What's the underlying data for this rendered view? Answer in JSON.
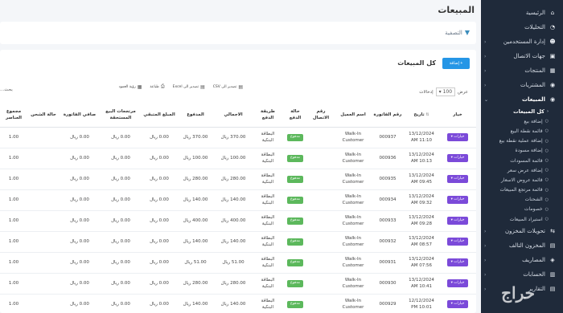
{
  "page": {
    "title": "المبيعات"
  },
  "filter": {
    "label": "التصفية"
  },
  "card": {
    "title": "كل المبيعات",
    "add_label": "+ إضافة"
  },
  "length": {
    "show_label": "عرض",
    "value": "100",
    "entries_label": "إدخالات"
  },
  "exports": [
    {
      "label": "تصدير الى CSV",
      "icon": "file-csv-icon",
      "glyph": "▤"
    },
    {
      "label": "تصدير الى Excel",
      "icon": "file-excel-icon",
      "glyph": "▤"
    },
    {
      "label": "طباعة",
      "icon": "print-icon",
      "glyph": "⎙"
    },
    {
      "label": "رؤية العمود",
      "icon": "columns-icon",
      "glyph": "▦"
    }
  ],
  "search_label": "بحث...",
  "sidebar": {
    "items": [
      {
        "label": "الرئيسية",
        "icon": "home-icon",
        "glyph": "⌂",
        "chev": ""
      },
      {
        "label": "التحليلات",
        "icon": "chart-icon",
        "glyph": "◔",
        "chev": ""
      },
      {
        "label": "إدارة المستخدمين",
        "icon": "users-icon",
        "glyph": "☻",
        "chev": "‹"
      },
      {
        "label": "جهات الاتصال",
        "icon": "contacts-icon",
        "glyph": "▣",
        "chev": "‹"
      },
      {
        "label": "المنتجات",
        "icon": "box-icon",
        "glyph": "▦",
        "chev": "‹"
      },
      {
        "label": "المشتريات",
        "icon": "cart-icon",
        "glyph": "◉",
        "chev": "‹"
      },
      {
        "label": "المبيعات",
        "icon": "sales-icon",
        "glyph": "◉",
        "chev": "⌄"
      }
    ],
    "sub_items": [
      "كل المبيعات",
      "إضافة بيع",
      "قائمة نقطة البيع",
      "إضافة عملية نقطة بيع",
      "إضافة مسودة",
      "قائمة المسودات",
      "إضافة عرض سعر",
      "قائمة عروض الاسعار",
      "قائمة مرتجع المبيعات",
      "الشحنات",
      "خصومات",
      "استيراد المبيعات"
    ],
    "items_after": [
      {
        "label": "تحويلات المخزون",
        "icon": "truck-icon",
        "glyph": "⇆",
        "chev": "‹"
      },
      {
        "label": "المخزون التالف",
        "icon": "damaged-stock-icon",
        "glyph": "▤",
        "chev": "‹"
      },
      {
        "label": "المصاريف",
        "icon": "expenses-icon",
        "glyph": "◈",
        "chev": "‹"
      },
      {
        "label": "الحسابات",
        "icon": "accounts-icon",
        "glyph": "▥",
        "chev": "‹"
      },
      {
        "label": "التقارير",
        "icon": "reports-icon",
        "glyph": "▤",
        "chev": "‹"
      }
    ]
  },
  "table": {
    "columns": [
      "خيار",
      "تاريخ",
      "رقم الفاتورة",
      "اسم العميل",
      "رقم الاتصال",
      "حالة الدفع",
      "طريقة الدفع",
      "الاجمالي",
      "المدفوع",
      "المبلغ المتبقي",
      "مرتجعات البيع المستحقة",
      "صافي الفاتورة",
      "حالة الشحن",
      "مجموع العناصر"
    ],
    "option_label": "خيارات ▾",
    "customer_line1": "Walk-In",
    "customer_line2": "Customer",
    "paid_label": "مدفوع",
    "method_line1": "البطاقة",
    "method_line2": "البنكية",
    "rows": [
      {
        "date1": "13/12/2024",
        "date2": "AM 11:10",
        "invoice": "000937",
        "total": "370.00 ريال",
        "paid": "370.00 ريال",
        "due": "0.00 ريال",
        "returns": "0.00 ريال",
        "net": "0.00 ريال",
        "items": "1.00"
      },
      {
        "date1": "13/12/2024",
        "date2": "AM 10:13",
        "invoice": "000936",
        "total": "100.00 ريال",
        "paid": "100.00 ريال",
        "due": "0.00 ريال",
        "returns": "0.00 ريال",
        "net": "0.00 ريال",
        "items": "1.00"
      },
      {
        "date1": "13/12/2024",
        "date2": "AM 09:45",
        "invoice": "000935",
        "total": "280.00 ريال",
        "paid": "280.00 ريال",
        "due": "0.00 ريال",
        "returns": "0.00 ريال",
        "net": "0.00 ريال",
        "items": "1.00"
      },
      {
        "date1": "13/12/2024",
        "date2": "AM 09:32",
        "invoice": "000934",
        "total": "140.00 ريال",
        "paid": "140.00 ريال",
        "due": "0.00 ريال",
        "returns": "0.00 ريال",
        "net": "0.00 ريال",
        "items": "1.00"
      },
      {
        "date1": "13/12/2024",
        "date2": "AM 09:28",
        "invoice": "000933",
        "total": "400.00 ريال",
        "paid": "400.00 ريال",
        "due": "0.00 ريال",
        "returns": "0.00 ريال",
        "net": "0.00 ريال",
        "items": "1.00"
      },
      {
        "date1": "13/12/2024",
        "date2": "AM 08:57",
        "invoice": "000932",
        "total": "140.00 ريال",
        "paid": "140.00 ريال",
        "due": "0.00 ريال",
        "returns": "0.00 ريال",
        "net": "0.00 ريال",
        "items": "1.00"
      },
      {
        "date1": "13/12/2024",
        "date2": "AM 07:56",
        "invoice": "000931",
        "total": "51.00 ريال",
        "paid": "51.00 ريال",
        "due": "0.00 ريال",
        "returns": "0.00 ريال",
        "net": "0.00 ريال",
        "items": "1.00"
      },
      {
        "date1": "13/12/2024",
        "date2": "AM 10:41",
        "invoice": "000930",
        "total": "280.00 ريال",
        "paid": "280.00 ريال",
        "due": "0.00 ريال",
        "returns": "0.00 ريال",
        "net": "0.00 ريال",
        "items": "1.00"
      },
      {
        "date1": "12/12/2024",
        "date2": "PM 10:01",
        "invoice": "000929",
        "total": "140.00 ريال",
        "paid": "140.00 ريال",
        "due": "0.00 ريال",
        "returns": "0.00 ريال",
        "net": "0.00 ريال",
        "items": "1.00"
      }
    ]
  },
  "watermark": "حراج",
  "colors": {
    "sidebar": "#1f2a3a",
    "accent": "#2596e6",
    "option": "#7b4ad9",
    "paid": "#5cb85c"
  }
}
